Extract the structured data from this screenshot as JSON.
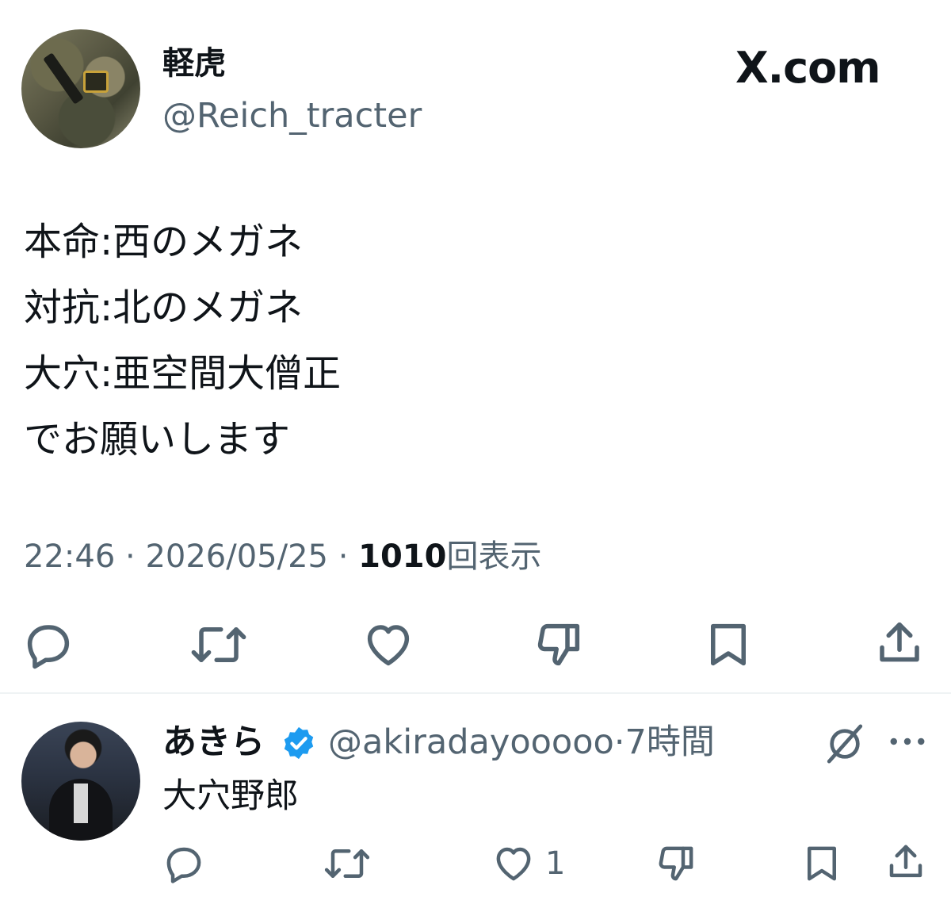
{
  "post": {
    "display_name": "軽虎",
    "handle": "@Reich_tracter",
    "brand": "X.com",
    "lines": [
      "本命:西のメガネ",
      "対抗:北のメガネ",
      "大穴:亜空間大僧正",
      "でお願いします"
    ],
    "time": "22:46",
    "date": "2026/05/25",
    "separator": "·",
    "views": "1010",
    "views_label": "回表示"
  },
  "actions": [
    "comment-icon",
    "retweet-icon",
    "heart-icon",
    "dislike-icon",
    "bookmark-icon",
    "share-icon"
  ],
  "reply": {
    "display_name": "あきら",
    "verified_color": "#1d9bf0",
    "handle": "@akiradayooooo",
    "separator": "·",
    "age": "7時間",
    "text": "大穴野郎",
    "like_count": "1"
  },
  "colors": {
    "text": "#0f1419",
    "muted": "#536471",
    "verified": "#1d9bf0"
  }
}
